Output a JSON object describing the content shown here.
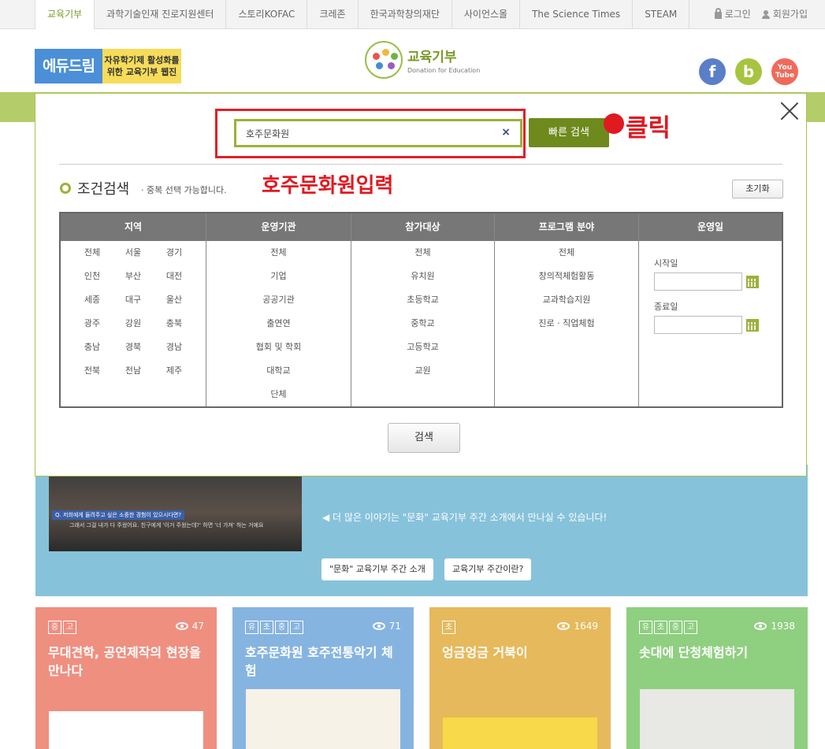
{
  "topnav": {
    "tabs": [
      "교육기부",
      "과학기술인재 진로지원센터",
      "스토리KOFAC",
      "크레존",
      "한국과학창의재단",
      "사이언스올",
      "The Science Times",
      "STEAM"
    ],
    "login": "로그인",
    "signup": "회원가입"
  },
  "header": {
    "edudream_left": "에듀드림",
    "edudream_right_1": "자유학기제 활성화를",
    "edudream_right_2": "위한 교육기부 웹진",
    "logo_title": "교육기부",
    "logo_sub": "Donation for Education",
    "social": {
      "facebook": "f",
      "blog": "b",
      "youtube_1": "You",
      "youtube_2": "Tube"
    }
  },
  "modal": {
    "search_value": "호주문화원",
    "quick_search": "빠른 검색",
    "annotation_click": "클릭",
    "condition_title": "조건검색",
    "condition_note": "· 중복 선택 가능합니다.",
    "annotation_input": "호주문화원입력",
    "reset": "초기화",
    "columns": {
      "region": {
        "title": "지역",
        "items": [
          "전체",
          "서울",
          "경기",
          "인천",
          "부산",
          "대전",
          "세종",
          "대구",
          "울산",
          "광주",
          "강원",
          "충북",
          "충남",
          "경북",
          "경남",
          "전북",
          "전남",
          "제주"
        ]
      },
      "org": {
        "title": "운영기관",
        "items": [
          "전체",
          "기업",
          "공공기관",
          "출연연",
          "협회 및 학회",
          "대학교",
          "단체"
        ]
      },
      "target": {
        "title": "참가대상",
        "items": [
          "전체",
          "유치원",
          "초등학교",
          "중학교",
          "고등학교",
          "교원"
        ]
      },
      "field": {
        "title": "프로그램 분야",
        "items": [
          "전체",
          "창의적체험활동",
          "교과학습지원",
          "진로 · 직업체험"
        ]
      },
      "date": {
        "title": "운영일",
        "start_label": "시작일",
        "end_label": "종료일"
      }
    },
    "search_button": "검색"
  },
  "background": {
    "video_caption_1": "Q. 저희에게 들려주고 싶은 소중한 경험이 있으시다면?",
    "video_caption_2": "그래서 그걸 내가 다 주웠어요. 친구에게 '이거 주웠는데?' 하면 '너 가져' 하는 거예요",
    "more_text": "◀ 더 많은 이야기는 \"문화\" 교육기부 주간 소개에서 만나실 수 있습니다!",
    "btn_intro": "\"문화\" 교육기부 주간 소개",
    "btn_what": "교육기부 주간이란?"
  },
  "cards": [
    {
      "badges": [
        "중",
        "고"
      ],
      "views": "47",
      "title": "무대견학, 공연제작의 현장을 만나다",
      "color": "#ef8f80"
    },
    {
      "badges": [
        "유",
        "초",
        "중",
        "고"
      ],
      "views": "71",
      "title": "호주문화원 호주전통악기 체험",
      "color": "#86b4e0"
    },
    {
      "badges": [
        "초"
      ],
      "views": "1649",
      "title": "엉금엉금 거북이",
      "color": "#e6b95c"
    },
    {
      "badges": [
        "유",
        "초",
        "중",
        "고"
      ],
      "views": "1938",
      "title": "솟대에 단청체험하기",
      "color": "#8fcf80"
    }
  ]
}
